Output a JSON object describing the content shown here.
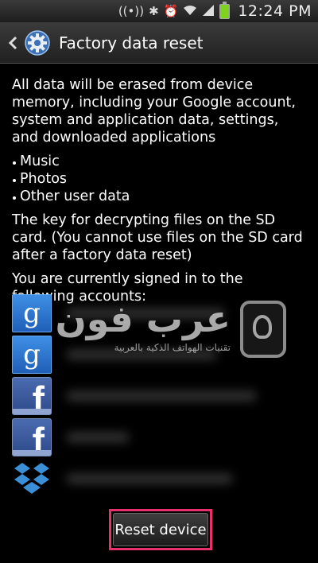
{
  "status_bar": {
    "icons": [
      "nfc-icon",
      "bluetooth-icon",
      "alarm-icon",
      "wifi-icon",
      "signal-icon",
      "battery-icon"
    ],
    "time": "12:24 PM",
    "battery_color": "#7ed321"
  },
  "header": {
    "title": "Factory data reset",
    "back_icon": "chevron-left-icon",
    "app_icon": "gear-icon"
  },
  "body": {
    "intro": "All data will be erased from device memory, including your Google account, system and application data, settings, and downloaded applications",
    "items": [
      "Music",
      "Photos",
      "Other user data"
    ],
    "sd_note": "The key for decrypting files on the SD card. (You cannot use files on the SD card after a factory data reset)",
    "accounts_label": "You are currently signed in to the following accounts:"
  },
  "accounts": [
    {
      "icon": "google-icon",
      "glyph": "g"
    },
    {
      "icon": "google-icon",
      "glyph": "g"
    },
    {
      "icon": "facebook-icon",
      "glyph": "f"
    },
    {
      "icon": "facebook-icon",
      "glyph": "f"
    },
    {
      "icon": "dropbox-icon",
      "glyph": ""
    }
  ],
  "watermark": {
    "title": "عرب فون",
    "subtitle": "تقنيات الهواتف الذكية بالعربية"
  },
  "reset_button": {
    "label": "Reset device",
    "highlight_color": "#e8306e"
  }
}
